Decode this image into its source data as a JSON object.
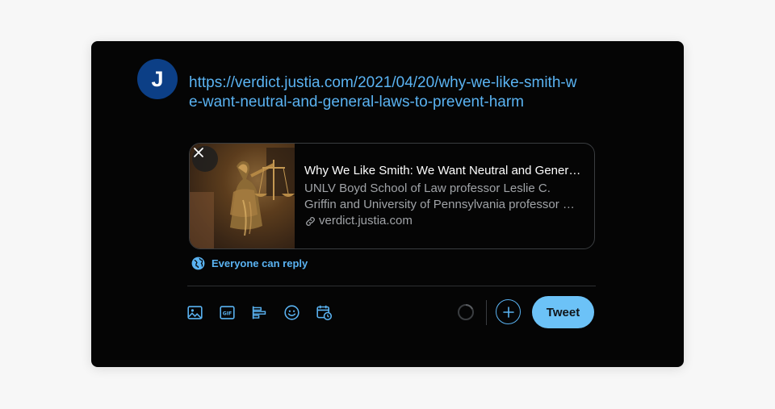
{
  "composer": {
    "avatar_initial": "J",
    "tweet_text": "https://verdict.justia.com/2021/04/20/why-we-like-smith-we-want-neutral-and-general-laws-to-prevent-harm",
    "link_card": {
      "title": "Why We Like Smith: We Want Neutral and General Laws to Prevent Harm",
      "description": "UNLV Boyd School of Law professor Leslie C. Griffin and University of Pennsylvania professor …",
      "domain": "verdict.justia.com"
    },
    "reply_setting": "Everyone can reply",
    "tweet_button": "Tweet"
  },
  "icons": {
    "close": "close-icon",
    "globe": "globe-icon",
    "link": "link-icon",
    "media": "image-icon",
    "gif": "gif-icon",
    "poll": "poll-icon",
    "emoji": "emoji-icon",
    "schedule": "schedule-icon",
    "add": "plus-icon"
  },
  "colors": {
    "accent": "#5ab3f2",
    "tweet_button_bg": "#6cc2f7",
    "background": "#050505",
    "avatar_bg": "#0c3f86"
  }
}
